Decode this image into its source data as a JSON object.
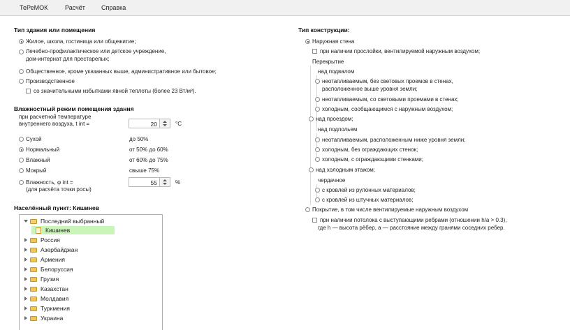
{
  "menu": [
    "ТеРеМОК",
    "Расчёт",
    "Справка"
  ],
  "left": {
    "building_type_title": "Тип здания или помещения",
    "building_types": [
      "Жилое, школа, гостиница или общежитие;",
      "Лечебно-профилактическое или детское учреждение,",
      "дом-интернат для престарелых;",
      "Общественное, кроме указанных выше, административное или бытовое;",
      "Производственное",
      "со значительными избытками явной теплоты (более 23 Вт/м³)."
    ],
    "humidity_title": "Влажностный режим помещения здания",
    "temp_label_1": "при расчетной температуре",
    "temp_label_2": "внутреннего воздуха, t int =",
    "temp_value": "20",
    "temp_unit": "°C",
    "modes": [
      {
        "name": "Сухой",
        "range": "до 50%"
      },
      {
        "name": "Нормальный",
        "range": "от 50% до 60%"
      },
      {
        "name": "Влажный",
        "range": "от 60% до 75%"
      },
      {
        "name": "Мокрый",
        "range": "свыше 75%"
      }
    ],
    "humidity_label_1": "Влажность, φ int =",
    "humidity_label_2": "(для расчёта точки росы)",
    "humidity_value": "55",
    "humidity_unit": "%",
    "locality_title": "Населённый пункт: Кишинев",
    "tree": {
      "root": "Последний выбранный",
      "selected": "Кишинев",
      "items": [
        "Россия",
        "Азербайджан",
        "Армения",
        "Белоруссия",
        "Грузия",
        "Казахстан",
        "Молдавия",
        "Туркмения",
        "Украина"
      ]
    }
  },
  "right": {
    "construction_title": "Тип конструкции:",
    "outer_wall": "Наружная стена",
    "outer_wall_opt": "при наличии прослойки, вентилируемой наружным воздухом;",
    "floor": "Перекрытие",
    "over_basement": "над подвалом",
    "b1a": "неотапливаемым, без световых проемов в стенах,",
    "b1b": "расположенное выше уровня земли;",
    "b2": "неотапливаемым, со световыми проемами в стенах;",
    "b3": "холодным, сообщающимся с наружным воздухом;",
    "over_passage": "над проездом;",
    "over_underground": "над подпольем",
    "u1": "неотапливаемым, расположенным ниже уровня земли;",
    "u2": "холодным, без ограждающих стенок;",
    "u3": "холодным, с ограждающими стенками;",
    "over_cold_floor": "над  холодным этажом;",
    "attic": "чердачное",
    "a1": "с кровлей из рулонных материалов;",
    "a2": "с кровлей из штучных материалов;",
    "cover": "Покрытие, в том числе вентилируемые наружным воздухом",
    "cover_opt_1": "при наличии потолока с выступающими ребрами (отношении h/a > 0.3),",
    "cover_opt_2": "где h — высота рёбер, a — расстояние между гранями соседних ребер."
  }
}
